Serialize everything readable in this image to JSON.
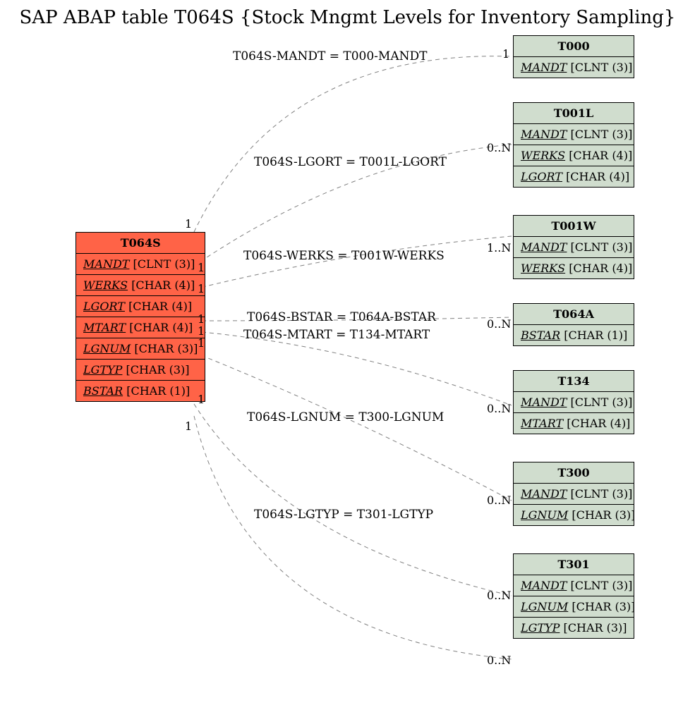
{
  "title": "SAP ABAP table T064S {Stock Mngmt Levels for Inventory Sampling}",
  "main_table": {
    "name": "T064S",
    "fields": [
      {
        "name": "MANDT",
        "type": "[CLNT (3)]"
      },
      {
        "name": "WERKS",
        "type": "[CHAR (4)]"
      },
      {
        "name": "LGORT",
        "type": "[CHAR (4)]"
      },
      {
        "name": "MTART",
        "type": "[CHAR (4)]"
      },
      {
        "name": "LGNUM",
        "type": "[CHAR (3)]"
      },
      {
        "name": "LGTYP",
        "type": "[CHAR (3)]"
      },
      {
        "name": "BSTAR",
        "type": "[CHAR (1)]"
      }
    ]
  },
  "ref_tables": {
    "T000": {
      "name": "T000",
      "fields": [
        {
          "name": "MANDT",
          "type": "[CLNT (3)]"
        }
      ]
    },
    "T001L": {
      "name": "T001L",
      "fields": [
        {
          "name": "MANDT",
          "type": "[CLNT (3)]"
        },
        {
          "name": "WERKS",
          "type": "[CHAR (4)]"
        },
        {
          "name": "LGORT",
          "type": "[CHAR (4)]"
        }
      ]
    },
    "T001W": {
      "name": "T001W",
      "fields": [
        {
          "name": "MANDT",
          "type": "[CLNT (3)]"
        },
        {
          "name": "WERKS",
          "type": "[CHAR (4)]"
        }
      ]
    },
    "T064A": {
      "name": "T064A",
      "fields": [
        {
          "name": "BSTAR",
          "type": "[CHAR (1)]"
        }
      ]
    },
    "T134": {
      "name": "T134",
      "fields": [
        {
          "name": "MANDT",
          "type": "[CLNT (3)]"
        },
        {
          "name": "MTART",
          "type": "[CHAR (4)]"
        }
      ]
    },
    "T300": {
      "name": "T300",
      "fields": [
        {
          "name": "MANDT",
          "type": "[CLNT (3)]"
        },
        {
          "name": "LGNUM",
          "type": "[CHAR (3)]"
        }
      ]
    },
    "T301": {
      "name": "T301",
      "fields": [
        {
          "name": "MANDT",
          "type": "[CLNT (3)]"
        },
        {
          "name": "LGNUM",
          "type": "[CHAR (3)]"
        },
        {
          "name": "LGTYP",
          "type": "[CHAR (3)]"
        }
      ]
    }
  },
  "relations": {
    "r0": {
      "label": "T064S-MANDT = T000-MANDT",
      "left_card": "1",
      "right_card": "1"
    },
    "r1": {
      "label": "T064S-LGORT = T001L-LGORT",
      "left_card": "1",
      "right_card": "0..N"
    },
    "r2": {
      "label": "T064S-WERKS = T001W-WERKS",
      "left_card": "1",
      "right_card": "1..N"
    },
    "r3": {
      "label": "T064S-BSTAR = T064A-BSTAR",
      "left_card": "1",
      "right_card": "0..N"
    },
    "r4": {
      "label": "T064S-MTART = T134-MTART",
      "left_card": "1",
      "right_card": ""
    },
    "r5": {
      "label": "T064S-LGNUM = T300-LGNUM",
      "left_card": "1",
      "right_card": "0..N"
    },
    "r6": {
      "label": "T064S-LGTYP = T301-LGTYP",
      "left_card": "1",
      "right_card": "0..N"
    },
    "r7": {
      "label": "",
      "left_card": "1",
      "right_card": "0..N"
    }
  }
}
